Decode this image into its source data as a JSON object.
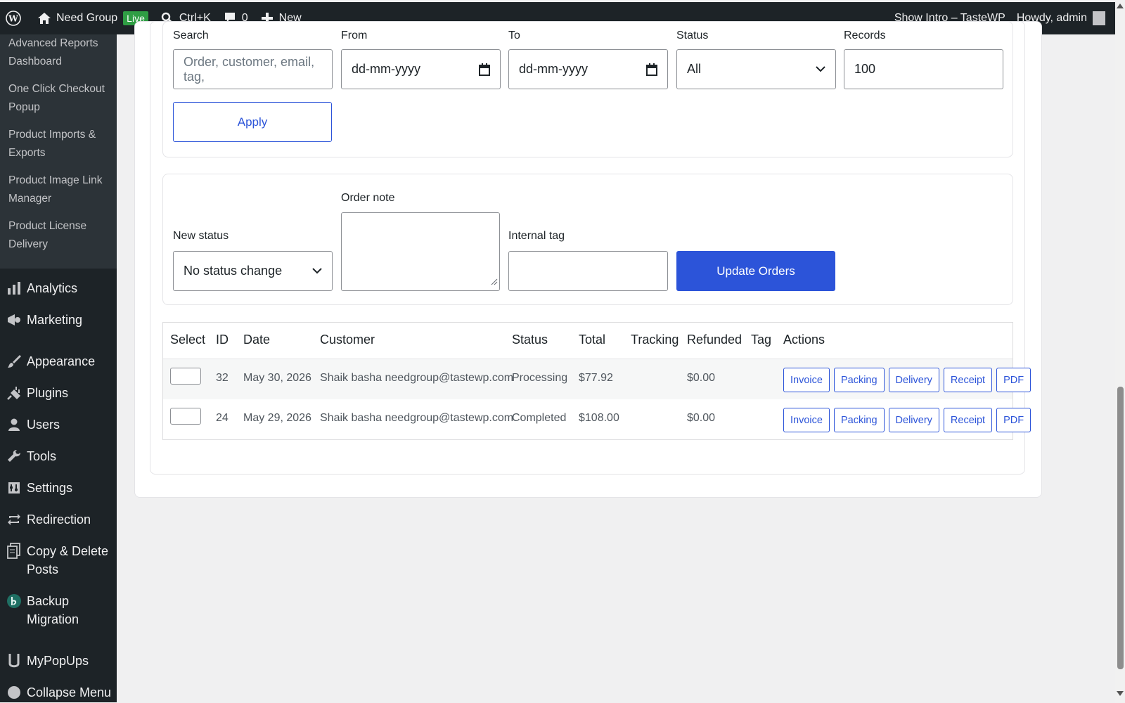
{
  "adminbar": {
    "site_name": "Need Group",
    "live_label": "Live",
    "search_shortcut": "Ctrl+K",
    "comments_count": "0",
    "new_label": "New",
    "show_intro": "Show Intro – TasteWP",
    "howdy": "Howdy, admin"
  },
  "sidebar": {
    "submenu": [
      {
        "label": "Advanced Reports Dashboard"
      },
      {
        "label": "One Click Checkout Popup"
      },
      {
        "label": "Product Imports & Exports"
      },
      {
        "label": "Product Image Link Manager"
      },
      {
        "label": "Product License Delivery"
      }
    ],
    "menu": [
      {
        "label": "Analytics",
        "icon": "bar-chart-icon"
      },
      {
        "label": "Marketing",
        "icon": "megaphone-icon"
      },
      {
        "label": "Appearance",
        "icon": "paintbrush-icon"
      },
      {
        "label": "Plugins",
        "icon": "plug-icon"
      },
      {
        "label": "Users",
        "icon": "user-icon"
      },
      {
        "label": "Tools",
        "icon": "wrench-icon"
      },
      {
        "label": "Settings",
        "icon": "settings-icon"
      },
      {
        "label": "Redirection",
        "icon": "redirect-icon"
      },
      {
        "label": "Copy & Delete Posts",
        "icon": "copy-icon"
      },
      {
        "label": "Backup Migration",
        "icon": "backup-icon"
      },
      {
        "label": "MyPopUps",
        "icon": "popup-icon"
      },
      {
        "label": "Collapse Menu",
        "icon": "collapse-icon"
      }
    ]
  },
  "filters": {
    "search_label": "Search",
    "search_placeholder": "Order, customer, email, tag,",
    "from_label": "From",
    "from_value": "dd-mm-yyyy",
    "to_label": "To",
    "to_value": "dd-mm-yyyy",
    "status_label": "Status",
    "status_value": "All",
    "records_label": "Records",
    "records_value": "100",
    "apply_label": "Apply"
  },
  "bulk": {
    "new_status_label": "New status",
    "new_status_value": "No status change",
    "order_note_label": "Order note",
    "internal_tag_label": "Internal tag",
    "update_label": "Update Orders"
  },
  "table": {
    "headers": [
      "Select",
      "ID",
      "Date",
      "Customer",
      "Status",
      "Total",
      "Tracking",
      "Refunded",
      "Tag",
      "Actions"
    ],
    "rows": [
      {
        "id": "32",
        "date": "May 30, 2026",
        "customer": "Shaik basha needgroup@tastewp.com",
        "status": "Processing",
        "total": "$77.92",
        "tracking": "",
        "refunded": "$0.00",
        "tag": ""
      },
      {
        "id": "24",
        "date": "May 29, 2026",
        "customer": "Shaik basha needgroup@tastewp.com",
        "status": "Completed",
        "total": "$108.00",
        "tracking": "",
        "refunded": "$0.00",
        "tag": ""
      }
    ],
    "actions": [
      "Invoice",
      "Packing",
      "Delivery",
      "Receipt",
      "PDF"
    ]
  },
  "colors": {
    "accent": "#2c54d9",
    "adminbar": "#1d2327",
    "live_badge": "#2f9e44"
  }
}
